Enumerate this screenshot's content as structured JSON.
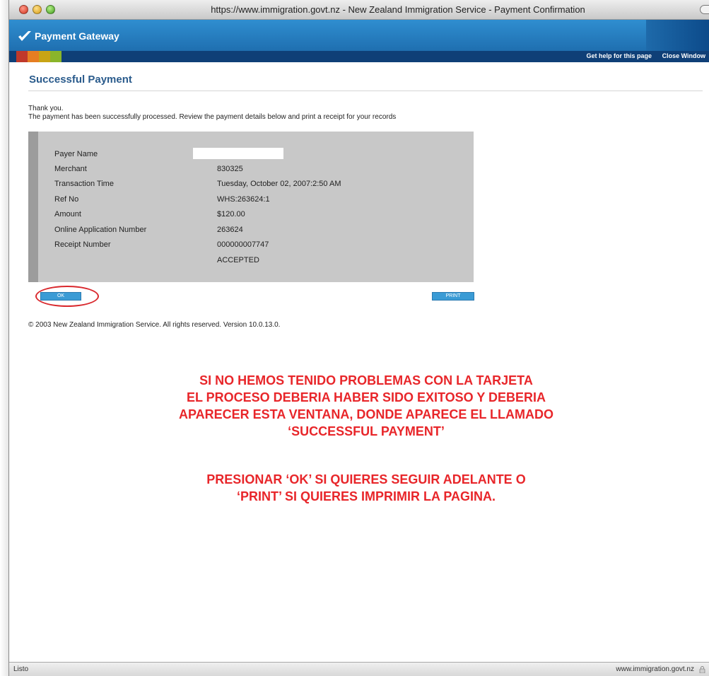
{
  "window": {
    "title": "https://www.immigration.govt.nz - New Zealand Immigration Service - Payment Confirmation"
  },
  "header": {
    "logo_text": "Payment Gateway",
    "help_link": "Get help for this page",
    "close_link": "Close Window"
  },
  "page": {
    "title": "Successful Payment",
    "thanks_line1": "Thank you.",
    "thanks_line2": "The payment has been successfully processed. Review the payment details below and print a receipt for your records"
  },
  "details": {
    "rows": [
      {
        "label": "Payer Name",
        "value": ""
      },
      {
        "label": "Merchant",
        "value": "830325"
      },
      {
        "label": "Transaction Time",
        "value": "Tuesday, October 02, 2007:2:50 AM"
      },
      {
        "label": "Ref No",
        "value": "WHS:263624:1"
      },
      {
        "label": "Amount",
        "value": "$120.00"
      },
      {
        "label": "Online Application Number",
        "value": "263624"
      },
      {
        "label": "Receipt Number",
        "value": "000000007747"
      }
    ],
    "status": "ACCEPTED"
  },
  "buttons": {
    "ok": "OK",
    "print": "PRINT"
  },
  "footer": {
    "copyright": "© 2003 New Zealand Immigration Service. All rights reserved. Version 10.0.13.0."
  },
  "annotation": {
    "block1": [
      "SI NO HEMOS TENIDO PROBLEMAS CON LA TARJETA",
      "EL PROCESO DEBERIA HABER SIDO EXITOSO Y DEBERIA",
      "APARECER ESTA VENTANA, DONDE APARECE EL LLAMADO",
      "‘SUCCESSFUL PAYMENT’"
    ],
    "block2": [
      "PRESIONAR ‘OK’ SI QUIERES SEGUIR ADELANTE O",
      "‘PRINT’ SI QUIERES IMPRIMIR LA PAGINA."
    ]
  },
  "statusbar": {
    "left": "Listo",
    "right": "www.immigration.govt.nz"
  },
  "colors": {
    "header_blue": "#2f8ed0",
    "navy_bar": "#0f3f77",
    "title_blue": "#2a5b8c",
    "button_blue": "#3a9bd5",
    "annotation_red": "#e8262a"
  },
  "icons": {
    "logo": "checkmark-icon",
    "secure": "lock-icon"
  }
}
